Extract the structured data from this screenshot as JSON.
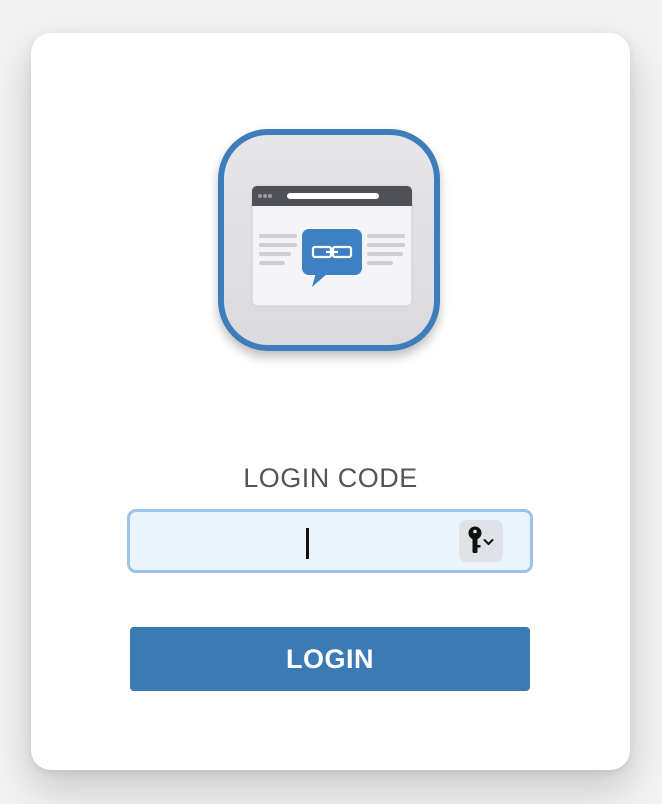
{
  "login": {
    "code_label": "LOGIN CODE",
    "code_value": "",
    "login_button_label": "LOGIN"
  },
  "icons": {
    "app": "browser-chat-link-icon",
    "key": "key-icon",
    "dropdown": "chevron-down-icon"
  },
  "colors": {
    "accent": "#3b7ab5",
    "field_background": "#ebf4fd",
    "field_border": "#9cc3e9"
  }
}
